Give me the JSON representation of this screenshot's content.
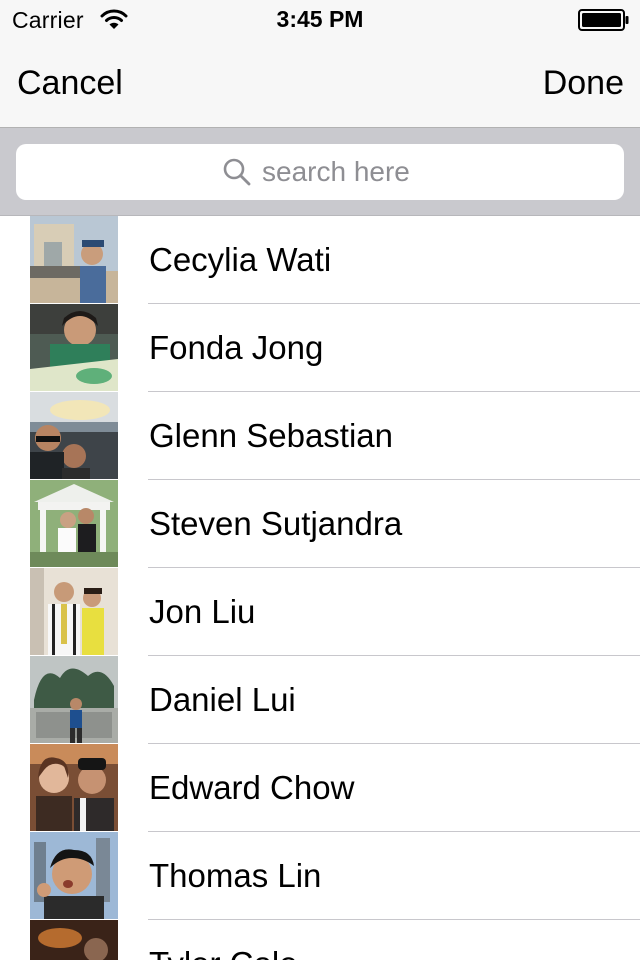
{
  "status_bar": {
    "carrier": "Carrier",
    "time": "3:45 PM",
    "wifi_icon": "wifi-icon",
    "battery_icon": "battery-icon"
  },
  "nav": {
    "cancel_label": "Cancel",
    "done_label": "Done"
  },
  "search": {
    "placeholder": "search here",
    "value": "",
    "icon": "magnifier-icon"
  },
  "contacts": [
    {
      "name": "Cecylia Wati"
    },
    {
      "name": "Fonda Jong"
    },
    {
      "name": "Glenn Sebastian"
    },
    {
      "name": "Steven Sutjandra"
    },
    {
      "name": "Jon Liu"
    },
    {
      "name": "Daniel Lui"
    },
    {
      "name": "Edward Chow"
    },
    {
      "name": "Thomas Lin"
    },
    {
      "name": "Tyler Cole"
    }
  ],
  "colors": {
    "bar_background": "#f7f7f7",
    "search_bar_background": "#c9c9ce",
    "separator": "#c8c7cc",
    "placeholder": "#8e8e93"
  }
}
